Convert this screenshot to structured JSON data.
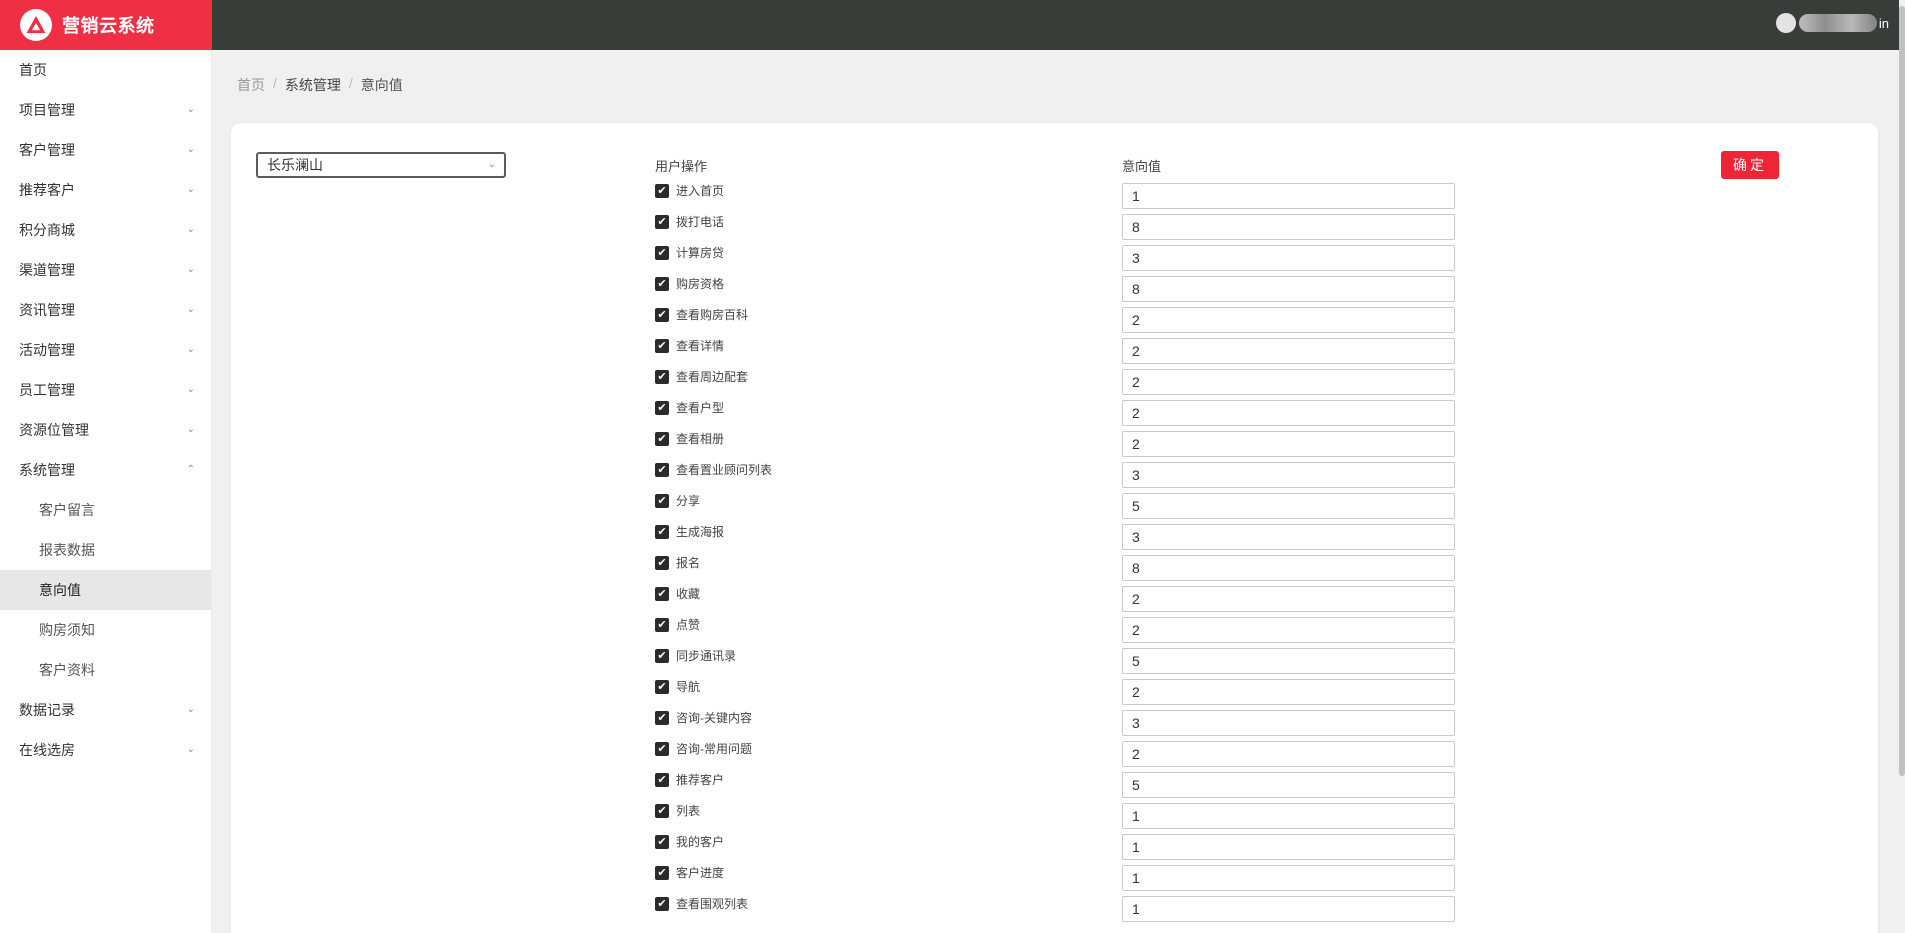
{
  "app": {
    "title": "营销云系统"
  },
  "header": {
    "username": "in"
  },
  "sidebar": {
    "items": [
      {
        "label": "首页",
        "chevron": ""
      },
      {
        "label": "项目管理",
        "chevron": "⌄"
      },
      {
        "label": "客户管理",
        "chevron": "⌄"
      },
      {
        "label": "推荐客户",
        "chevron": "⌄"
      },
      {
        "label": "积分商城",
        "chevron": "⌄"
      },
      {
        "label": "渠道管理",
        "chevron": "⌄"
      },
      {
        "label": "资讯管理",
        "chevron": "⌄"
      },
      {
        "label": "活动管理",
        "chevron": "⌄"
      },
      {
        "label": "员工管理",
        "chevron": "⌄"
      },
      {
        "label": "资源位管理",
        "chevron": "⌄"
      },
      {
        "label": "系统管理",
        "chevron": "⌃"
      }
    ],
    "sub_items": [
      {
        "label": "客户留言"
      },
      {
        "label": "报表数据"
      },
      {
        "label": "意向值"
      },
      {
        "label": "购房须知"
      },
      {
        "label": "客户资料"
      }
    ],
    "bottom_items": [
      {
        "label": "数据记录",
        "chevron": "⌄"
      },
      {
        "label": "在线选房",
        "chevron": "⌄"
      }
    ]
  },
  "breadcrumb": {
    "home": "首页",
    "section": "系统管理",
    "current": "意向值"
  },
  "form": {
    "project_select": "长乐澜山",
    "select_chevron": "⌄",
    "column_operation": "用户操作",
    "column_value": "意向值",
    "confirm_label": "确定",
    "check_glyph": "✔",
    "rows": [
      {
        "label": "进入首页",
        "value": "1"
      },
      {
        "label": "拨打电话",
        "value": "8"
      },
      {
        "label": "计算房贷",
        "value": "3"
      },
      {
        "label": "购房资格",
        "value": "8"
      },
      {
        "label": "查看购房百科",
        "value": "2"
      },
      {
        "label": "查看详情",
        "value": "2"
      },
      {
        "label": "查看周边配套",
        "value": "2"
      },
      {
        "label": "查看户型",
        "value": "2"
      },
      {
        "label": "查看相册",
        "value": "2"
      },
      {
        "label": "查看置业顾问列表",
        "value": "3"
      },
      {
        "label": "分享",
        "value": "5"
      },
      {
        "label": "生成海报",
        "value": "3"
      },
      {
        "label": "报名",
        "value": "8"
      },
      {
        "label": "收藏",
        "value": "2"
      },
      {
        "label": "点赞",
        "value": "2"
      },
      {
        "label": "同步通讯录",
        "value": "5"
      },
      {
        "label": "导航",
        "value": "2"
      },
      {
        "label": "咨询-关键内容",
        "value": "3"
      },
      {
        "label": "咨询-常用问题",
        "value": "2"
      },
      {
        "label": "推荐客户",
        "value": "5"
      },
      {
        "label": "列表",
        "value": "1"
      },
      {
        "label": "我的客户",
        "value": "1"
      },
      {
        "label": "客户进度",
        "value": "1"
      },
      {
        "label": "查看围观列表",
        "value": "1"
      }
    ]
  }
}
